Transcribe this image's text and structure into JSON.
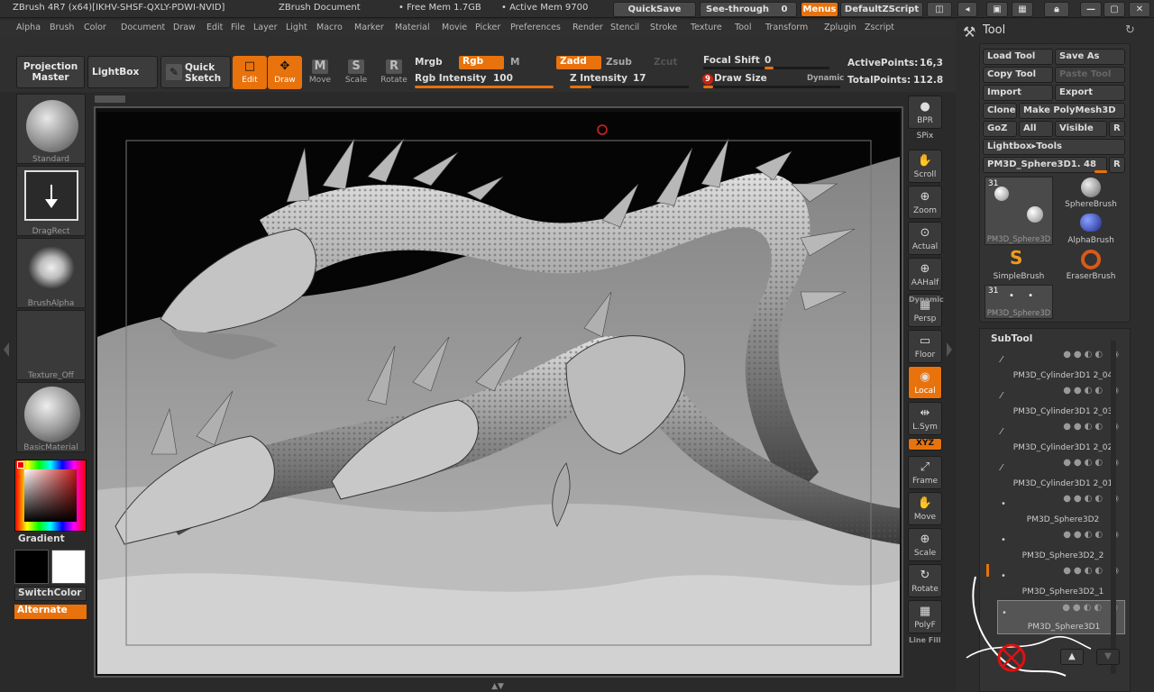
{
  "titlebar": {
    "app_title": "ZBrush 4R7 (x64)[IKHV-SHSF-QXLY-PDWI-NVID]",
    "doc": "ZBrush Document",
    "free_mem": "• Free Mem 1.7GB",
    "active_mem": "• Active Mem 9700",
    "quicksave": "QuickSave",
    "see_through": "See-through",
    "see_through_value": "0",
    "menus": "Menus",
    "script": "DefaultZScript"
  },
  "menubar": [
    "Alpha",
    "Brush",
    "Color",
    "Document",
    "Draw",
    "Edit",
    "File",
    "Layer",
    "Light",
    "Macro",
    "Marker",
    "Material",
    "Movie",
    "Picker",
    "Preferences",
    "Render",
    "Stencil",
    "Stroke",
    "Texture",
    "Tool",
    "Transform",
    "Zplugin",
    "Zscript"
  ],
  "toolbar": {
    "projection_master": "Projection Master",
    "lightbox": "LightBox",
    "quick_sketch": "Quick Sketch",
    "modes": [
      {
        "label": "Edit",
        "glyph": "□",
        "active": true
      },
      {
        "label": "Draw",
        "glyph": "✥",
        "active": true
      },
      {
        "label": "Move",
        "glyph": "M",
        "active": false
      },
      {
        "label": "Scale",
        "glyph": "S",
        "active": false
      },
      {
        "label": "Rotate",
        "glyph": "R",
        "active": false
      }
    ],
    "mrgb": "Mrgb",
    "rgb": "Rgb",
    "m": "M",
    "zadd": "Zadd",
    "zsub": "Zsub",
    "zcut": "Zcut",
    "rgb_intensity_label": "Rgb Intensity",
    "rgb_intensity": "100",
    "z_intensity_label": "Z Intensity",
    "z_intensity": "17",
    "focal_shift_label": "Focal Shift",
    "focal_shift": "0",
    "draw_size_label": "Draw Size",
    "draw_size": "9",
    "dynamic": "Dynamic",
    "active_points_label": "ActivePoints:",
    "active_points": "16,3",
    "total_points_label": "TotalPoints:",
    "total_points": "112.8"
  },
  "leftshelf": {
    "brush": "Standard",
    "stroke": "DragRect",
    "alpha": "BrushAlpha",
    "texture": "Texture_Off",
    "material": "BasicMaterial",
    "gradient": "Gradient",
    "switch_color": "SwitchColor",
    "alternate": "Alternate"
  },
  "rightshelf": [
    {
      "label": "BPR",
      "glyph": "●"
    },
    {
      "label": "SPix",
      "glyph": ""
    },
    {
      "label": "Scroll",
      "glyph": "✋"
    },
    {
      "label": "Zoom",
      "glyph": "⊕"
    },
    {
      "label": "Actual",
      "glyph": "⊙"
    },
    {
      "label": "AAHalf",
      "glyph": "⊕"
    },
    {
      "label": "Persp",
      "glyph": "▦"
    },
    {
      "label": "Floor",
      "glyph": "▭"
    },
    {
      "label": "Local",
      "glyph": "◉"
    },
    {
      "label": "L.Sym",
      "glyph": "⇹"
    },
    {
      "label": "XYZ",
      "glyph": ""
    },
    {
      "label": "Frame",
      "glyph": "⤢"
    },
    {
      "label": "Move",
      "glyph": "✋"
    },
    {
      "label": "Scale",
      "glyph": "⊕"
    },
    {
      "label": "Rotate",
      "glyph": "↻"
    },
    {
      "label": "PolyF",
      "glyph": "▦"
    }
  ],
  "right_extra": {
    "dynamic": "Dynamic",
    "line_fill": "Line Fill"
  },
  "toolpanel": {
    "title": "Tool",
    "load_tool": "Load Tool",
    "save_as": "Save As",
    "copy_tool": "Copy Tool",
    "paste_tool": "Paste Tool",
    "import": "Import",
    "export": "Export",
    "clone": "Clone",
    "make_polymesh": "Make PolyMesh3D",
    "goz": "GoZ",
    "all": "All",
    "visible": "Visible",
    "r": "R",
    "lightbox_tools": "Lightbox▸Tools",
    "current_tool": "PM3D_Sphere3D1. 48",
    "thumbs": [
      {
        "label": "PM3D_Sphere3D",
        "count": "31"
      },
      {
        "label": "SphereBrush"
      },
      {
        "label": "AlphaBrush"
      },
      {
        "label": "SimpleBrush"
      },
      {
        "label": "EraserBrush"
      },
      {
        "label": "PM3D_Sphere3D",
        "count": "31"
      }
    ],
    "subtool_title": "SubTool",
    "subtools": [
      "PM3D_Cylinder3D1 2_04",
      "PM3D_Cylinder3D1 2_03",
      "PM3D_Cylinder3D1 2_02",
      "PM3D_Cylinder3D1 2_01",
      "PM3D_Sphere3D2",
      "PM3D_Sphere3D2_2",
      "PM3D_Sphere3D2_1",
      "PM3D_Sphere3D1"
    ]
  }
}
